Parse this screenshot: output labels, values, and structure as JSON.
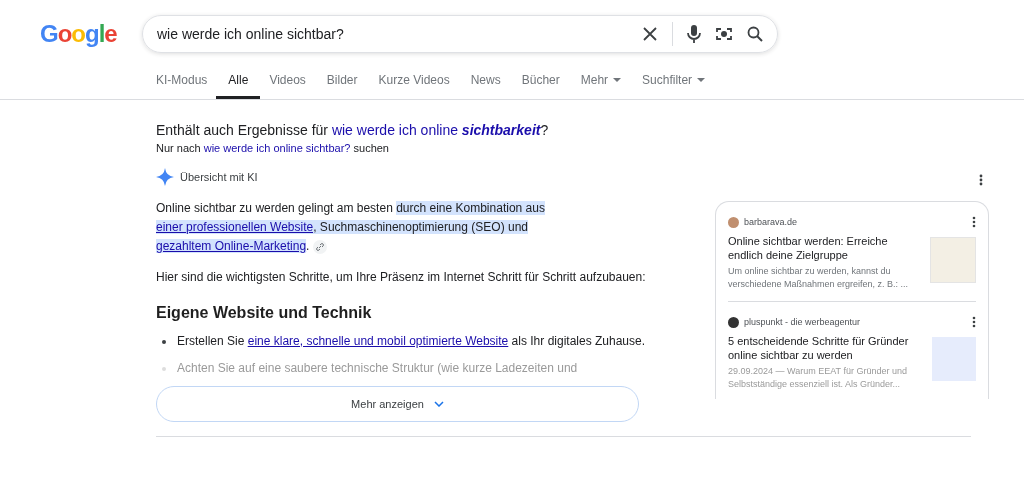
{
  "logo": "Google",
  "search": {
    "value": "wie werde ich online sichtbar?"
  },
  "tabs": [
    {
      "label": "KI-Modus",
      "selected": false
    },
    {
      "label": "Alle",
      "selected": true
    },
    {
      "label": "Videos",
      "selected": false
    },
    {
      "label": "Bilder",
      "selected": false
    },
    {
      "label": "Kurze Videos",
      "selected": false
    },
    {
      "label": "News",
      "selected": false
    },
    {
      "label": "Bücher",
      "selected": false
    },
    {
      "label": "Mehr",
      "selected": false,
      "kind": "menu"
    },
    {
      "label": "Suchfilter",
      "selected": false,
      "kind": "menu"
    }
  ],
  "spelling": {
    "prefix": "Enthält auch Ergebnisse für",
    "link": "wie werde ich online **sichtbarkeit**",
    "suffix": "?",
    "only_prefix": "Nur nach",
    "only_link": "wie werde ich online sichtbar?",
    "only_suffix": "suchen"
  },
  "ai_overview": {
    "title": "Übersicht mit KI",
    "summary": [
      {
        "kind": "plain",
        "text": "Online sichtbar zu werden gelingt am besten "
      },
      {
        "kind": "highlight",
        "text": "durch eine Kombination aus "
      },
      {
        "kind": "link",
        "text": "einer professionellen Website"
      },
      {
        "kind": "highlight",
        "text": ", Suchmaschinenoptimierung (SEO) und "
      },
      {
        "kind": "link",
        "text": "gezahltem Online-Marketing"
      },
      {
        "kind": "plain",
        "text": "."
      }
    ],
    "intro": "Hier sind die wichtigsten Schritte, um Ihre Präsenz im Internet Schritt für Schritt aufzubauen:",
    "heading": "Eigene Website und Technik",
    "bullets": [
      {
        "faded": false,
        "parts": [
          {
            "kind": "plain",
            "text": "Erstellen Sie "
          },
          {
            "kind": "link",
            "text": "eine klare, schnelle und mobil optimierte Website"
          },
          {
            "kind": "plain",
            "text": " als Ihr digitales Zuhause."
          }
        ]
      },
      {
        "faded": true,
        "parts": [
          {
            "kind": "plain",
            "text": "Achten Sie auf eine saubere technische Struktur (wie kurze Ladezeiten und"
          }
        ]
      }
    ],
    "more_button": "Mehr anzeigen",
    "sources": [
      {
        "site": "barbarava.de",
        "title": "Online sichtbar werden: Erreiche endlich deine Zielgruppe",
        "snippet": "Um online sichtbar zu werden, kannst du verschiedene Maßnahmen ergreifen, z. B.: ...",
        "faded": false
      },
      {
        "site": "pluspunkt - die werbeagentur",
        "title": "5 entscheidende Schritte für Gründer online sichtbar zu werden",
        "snippet": "29.09.2024 — Warum EEAT für Gründer und Selbstständige essenziell ist. Als Gründer...",
        "faded": true
      }
    ]
  }
}
